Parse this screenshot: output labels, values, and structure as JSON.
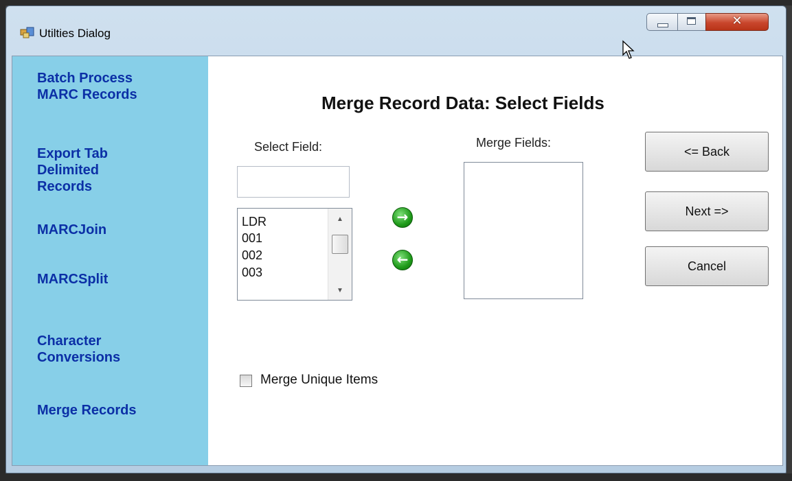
{
  "window": {
    "title": "Utilties Dialog"
  },
  "sidebar": {
    "items": [
      {
        "label_lines": [
          "Batch Process",
          "MARC Records"
        ]
      },
      {
        "label_lines": [
          "Export Tab",
          "Delimited",
          "Records"
        ]
      },
      {
        "label_lines": [
          "MARCJoin"
        ]
      },
      {
        "label_lines": [
          "MARCSplit"
        ]
      },
      {
        "label_lines": [
          "Character",
          "Conversions"
        ]
      },
      {
        "label_lines": [
          "Merge Records"
        ]
      }
    ]
  },
  "main": {
    "title": "Merge Record Data: Select Fields",
    "select_field_label": "Select Field:",
    "select_field_value": "",
    "field_list": [
      "LDR",
      "001",
      "002",
      "003"
    ],
    "merge_fields_label": "Merge Fields:",
    "merge_fields_items": [],
    "merge_unique_label": "Merge Unique Items",
    "merge_unique_checked": false
  },
  "buttons": {
    "back": "<= Back",
    "next": "Next =>",
    "cancel": "Cancel"
  },
  "icons": {
    "add_arrow": "arrow-right-circle-icon",
    "remove_arrow": "arrow-left-circle-icon"
  },
  "colors": {
    "sidebar_bg": "#87cfe8",
    "sidebar_link": "#0b2fa6",
    "arrow_green": "#1f9a1a",
    "close_red": "#c9462c"
  }
}
